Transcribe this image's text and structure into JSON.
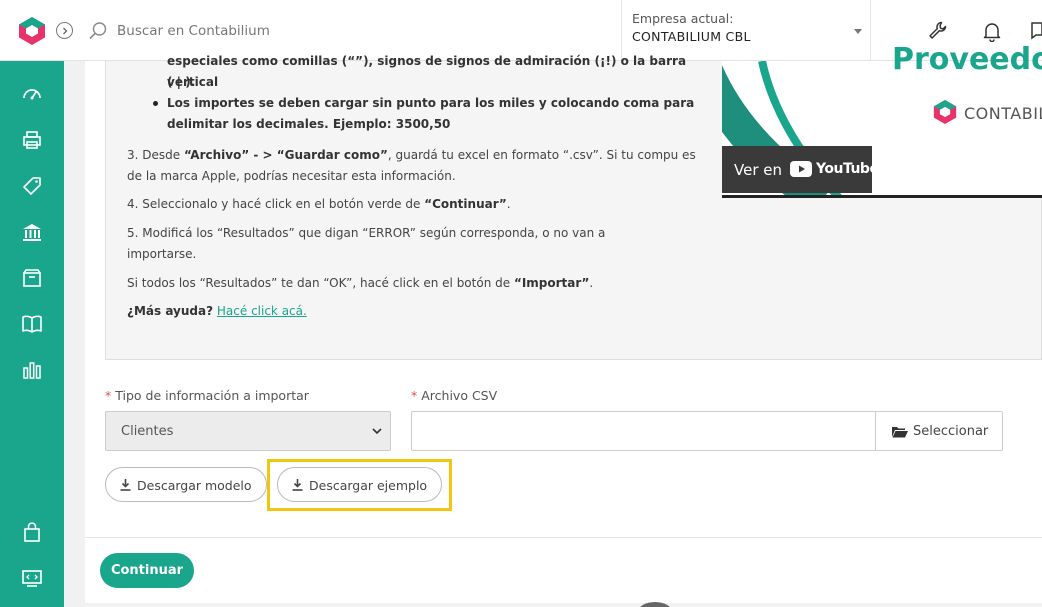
{
  "header": {
    "search_placeholder": "Buscar en Contabilium",
    "company_label": "Empresa actual:",
    "company_value": "CONTABILIUM CBL"
  },
  "sidebar": {
    "items": [
      "dashboard-icon",
      "printer-icon",
      "tag-icon",
      "bank-icon",
      "box-icon",
      "book-icon",
      "chart-icon"
    ],
    "bottom_items": [
      "bag-icon",
      "code-icon"
    ]
  },
  "instructions": {
    "bullet_partial_1": "especiales como comillas (“”), signos de signos de admiración (¡!) o la barra vertical",
    "bullet_partial_2": "( | ).",
    "bullet_2_line1": "Los importes se deben cargar sin punto para los miles y colocando coma para",
    "bullet_2_line2": "delimitar los decimales. Ejemplo: 3500,50",
    "step3_prefix": "3. Desde ",
    "step3_b1": "“Archivo” - > “Guardar como”",
    "step3_rest": ", guardá tu excel en formato “.csv”. Si tu compu es",
    "step3_line2": "de la marca Apple, podrías necesitar esta información.",
    "step4_prefix": "4. Seleccionalo y hacé click en el botón verde de ",
    "step4_b": "“Continuar”",
    "step4_suffix": ".",
    "step5_line1": "5. Modificá los “Resultados” que digan “ERROR” según corresponda, o no van a",
    "step5_line2": "importarse.",
    "ok_prefix": "Si todos los “Resultados” te dan “OK”, hacé click en el botón de ",
    "ok_b": "“Importar”",
    "ok_suffix": ".",
    "help_q": "¿Más ayuda?",
    "help_link": "Hacé click acá."
  },
  "video": {
    "watch_on": "Ver en",
    "platform": "YouTube",
    "title_partial": "Proveedo",
    "brand": "CONTABILIU"
  },
  "form": {
    "type_label": "Tipo de información a importar",
    "type_value": "Clientes",
    "csv_label": "Archivo CSV",
    "select_button": "Seleccionar",
    "required_mark": "*"
  },
  "actions": {
    "download_model": "Descargar modelo",
    "download_example": "Descargar ejemplo",
    "continue": "Continuar"
  },
  "colors": {
    "accent": "#1aa58d",
    "highlight": "#f2c50e"
  }
}
